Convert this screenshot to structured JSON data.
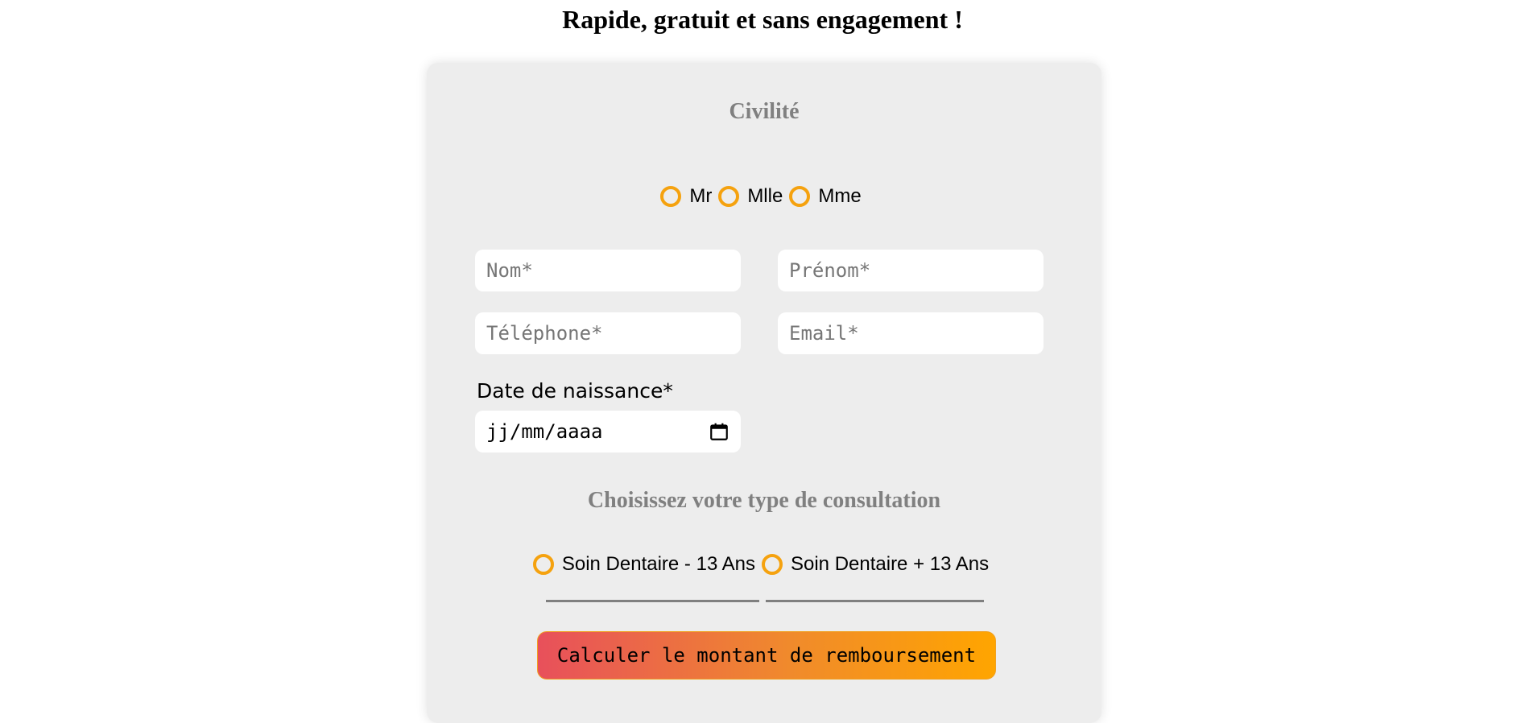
{
  "header": {
    "title": "Rapide, gratuit et sans engagement !"
  },
  "form": {
    "civility": {
      "title": "Civilité",
      "options": [
        "Mr",
        "Mlle",
        "Mme"
      ]
    },
    "fields": {
      "nom_placeholder": "Nom*",
      "prenom_placeholder": "Prénom*",
      "telephone_placeholder": "Téléphone*",
      "email_placeholder": "Email*"
    },
    "birthdate": {
      "label": "Date de naissance*",
      "placeholder": "jj/mm/aaaa",
      "icon": "calendar-icon"
    },
    "consultation": {
      "title": "Choisissez votre type de consultation",
      "options": [
        "Soin Dentaire - 13 Ans",
        "Soin Dentaire + 13 Ans"
      ]
    },
    "submit_label": "Calculer le montant de remboursement"
  },
  "colors": {
    "radio_accent": "#f5a20f",
    "card_background": "#ededed",
    "button_gradient_start": "#e8505b",
    "button_gradient_end": "#ffa500",
    "section_title": "#808080"
  }
}
